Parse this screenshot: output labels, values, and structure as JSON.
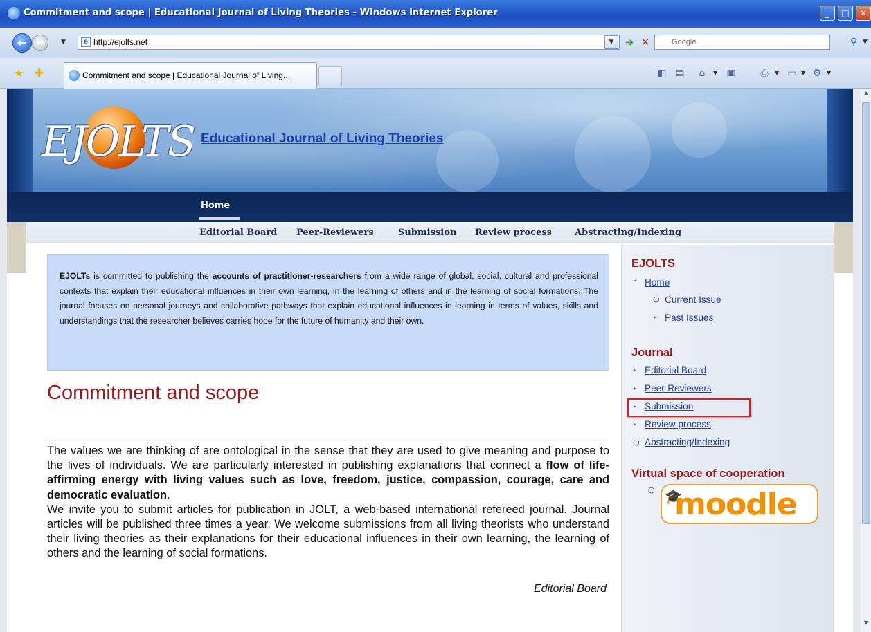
{
  "window": {
    "title": "Commitment and scope | Educational Journal of Living Theories - Windows Internet Explorer",
    "min": "_",
    "max": "□",
    "close": "✕"
  },
  "address": {
    "url": "http://ejolts.net",
    "search_placeholder": "Google"
  },
  "tab": {
    "label": "Commitment and scope | Educational Journal of Living..."
  },
  "icons": [
    "ie-logo-icon",
    "back-icon",
    "forward-icon",
    "page-icon",
    "go-icon",
    "stop-icon",
    "search-icon",
    "favorites-star-icon",
    "add-favorites-icon",
    "feeds-icon",
    "research-icon",
    "home-icon",
    "print-icon",
    "page-menu-icon",
    "tools-icon"
  ],
  "site": {
    "logo_text": "EJOLTS",
    "title": "Educational Journal of Living Theories",
    "nav_home": "Home",
    "subnav": [
      "Editorial Board",
      "Peer-Reviewers",
      "Submission",
      "Review process",
      "Abstracting/Indexing"
    ]
  },
  "intro": {
    "p1_a": "EJOLTs",
    "p1_b": " is committed to publishing the ",
    "p1_c": "accounts of practitioner-researchers",
    "p1_d": " from a wide range of global, social, cultural and professional contexts that explain their educational influences in their own learning, in the learning of others and in the learning of social formations. The journal focuses on personal journeys and collaborative pathways that explain educational influences in learning in terms of values, skills and understandings that the researcher believes carries hope for the future of humanity and their own."
  },
  "content": {
    "heading": "Commitment and scope",
    "para1_a": "The values we are thinking of are ontological in the sense that they are used to give meaning and purpose to the lives of individuals. We are particularly interested in publishing explanations that connect a ",
    "para1_b": "flow of life-affirming energy with living values such as love, freedom, justice, compassion, courage, care and democratic evaluation",
    "para1_c": ".",
    "para2": "We invite you to submit articles for publication in JOLT, a web-based international refereed journal. Journal articles will be published three times a year. We welcome submissions from all living theorists who understand their living theories as their explanations for their educational influences in their own learning, the learning of others and the learning of social formations.",
    "signature": "Editorial Board"
  },
  "sidebar": {
    "heading1": "EJOLTS",
    "home": "Home",
    "current_issue": "Current Issue",
    "past_issues": "Past Issues",
    "heading2": "Journal",
    "journal_links": [
      "Editorial Board",
      "Peer-Reviewers",
      "Submission",
      "Review process",
      "Abstracting/Indexing"
    ],
    "heading3": "Virtual space of cooperation",
    "moodle": "moodle"
  },
  "colors": {
    "heading_red": "#9b1b1b",
    "link_blue": "#1e3db0",
    "navbar": "#102f64",
    "intro_bg": "#c8dbf8",
    "highlight": "#d21f1f"
  }
}
